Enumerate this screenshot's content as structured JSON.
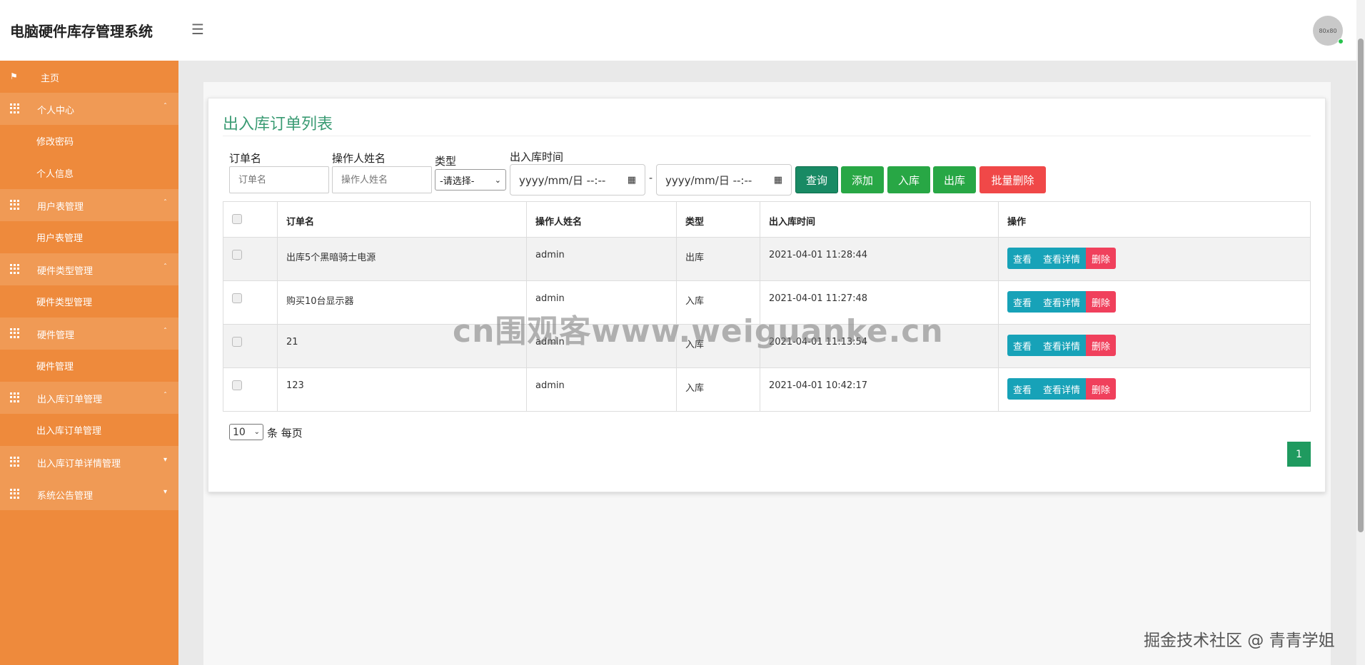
{
  "header": {
    "title": "电脑硬件库存管理系统",
    "avatar_text": "80x80"
  },
  "sidebar": {
    "items": [
      {
        "label": "主页"
      },
      {
        "label": "个人中心"
      },
      {
        "label": "修改密码"
      },
      {
        "label": "个人信息"
      },
      {
        "label": "用户表管理"
      },
      {
        "label": "用户表管理"
      },
      {
        "label": "硬件类型管理"
      },
      {
        "label": "硬件类型管理"
      },
      {
        "label": "硬件管理"
      },
      {
        "label": "硬件管理"
      },
      {
        "label": "出入库订单管理"
      },
      {
        "label": "出入库订单管理"
      },
      {
        "label": "出入库订单详情管理"
      },
      {
        "label": "系统公告管理"
      }
    ]
  },
  "main": {
    "page_title": "出入库订单列表",
    "filters": {
      "order_name_label": "订单名",
      "order_name_placeholder": "订单名",
      "operator_label": "操作人姓名",
      "operator_placeholder": "操作人姓名",
      "type_label": "类型",
      "type_value": "-请选择-",
      "time_label": "出入库时间",
      "date_start": "yyyy/mm/日 --:--",
      "date_sep": "-",
      "date_end": "yyyy/mm/日 --:--"
    },
    "buttons": {
      "query": "查询",
      "add": "添加",
      "stock_in": "入库",
      "stock_out": "出库",
      "batch_delete": "批量删除"
    },
    "table": {
      "columns": [
        "订单名",
        "操作人姓名",
        "类型",
        "出入库时间",
        "操作"
      ],
      "rows": [
        {
          "name": "出库5个黑暗骑士电源",
          "operator": "admin",
          "type": "出库",
          "time": "2021-04-01 11:28:44"
        },
        {
          "name": "购买10台显示器",
          "operator": "admin",
          "type": "入库",
          "time": "2021-04-01 11:27:48"
        },
        {
          "name": "21",
          "operator": "admin",
          "type": "入库",
          "time": "2021-04-01 11:13:54"
        },
        {
          "name": "123",
          "operator": "admin",
          "type": "入库",
          "time": "2021-04-01 10:42:17"
        }
      ],
      "actions": {
        "view": "查看",
        "detail": "查看详情",
        "delete": "删除"
      }
    },
    "pagination": {
      "page_size": "10",
      "page_size_suffix": "条 每页",
      "current_page": "1"
    }
  },
  "watermarks": {
    "center": "cn围观客www.weiguanke.cn",
    "corner": "掘金技术社区 @ 青青学姐"
  },
  "colors": {
    "sidebar": "#ee8a3c",
    "title": "#3a9b73",
    "green_button": "#28a745",
    "red_button": "#f04848",
    "info_button": "#17a2b8"
  }
}
